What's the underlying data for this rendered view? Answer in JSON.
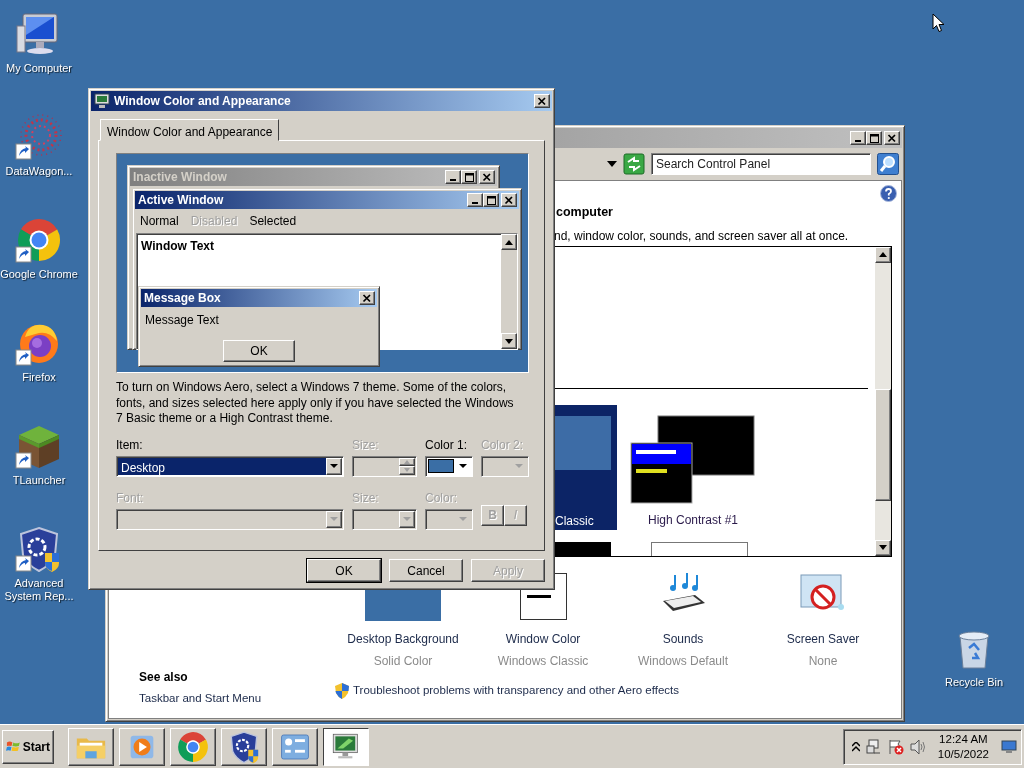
{
  "desktop_icons": [
    {
      "label": "My Computer",
      "kind": "computer",
      "shortcut": false
    },
    {
      "label": "DataWagon...",
      "kind": "dots",
      "shortcut": true
    },
    {
      "label": "Google Chrome",
      "kind": "ring",
      "shortcut": true
    },
    {
      "label": "Firefox",
      "kind": "flame",
      "shortcut": true
    },
    {
      "label": "TLauncher",
      "kind": "block",
      "shortcut": true
    },
    {
      "label": "Advanced System Rep...",
      "kind": "shield",
      "shortcut": true
    }
  ],
  "recycle_bin": {
    "label": "Recycle Bin"
  },
  "control_panel": {
    "search": {
      "placeholder": "Search Control Panel"
    },
    "heading": "computer",
    "description": "nd, window color, sounds, and screen saver all at once.",
    "themes": [
      {
        "label": "Classic",
        "kind": "classic",
        "selected": true
      },
      {
        "label": "High Contrast #1",
        "kind": "high_contrast",
        "selected": false
      }
    ],
    "settings": [
      {
        "kind": "background",
        "label": "Desktop Background",
        "value": "Solid Color"
      },
      {
        "kind": "window",
        "label": "Window Color",
        "value": "Windows Classic"
      },
      {
        "kind": "sounds",
        "label": "Sounds",
        "value": "Windows Default"
      },
      {
        "kind": "screensaver",
        "label": "Screen Saver",
        "value": "None"
      }
    ],
    "see_also": {
      "title": "See also",
      "links": [
        "Taskbar and Start Menu"
      ]
    },
    "troubleshoot_link": "Troubleshoot problems with transparency and other Aero effects"
  },
  "dialog": {
    "title": "Window Color and Appearance",
    "tabs": [
      {
        "label": "Window Color and Appearance",
        "selected": true
      }
    ],
    "preview": {
      "inactive_title": "Inactive Window",
      "active_title": "Active Window",
      "menu": [
        {
          "label": "Normal",
          "disabled": false
        },
        {
          "label": "Disabled",
          "disabled": true
        },
        {
          "label": "Selected",
          "disabled": false
        }
      ],
      "window_text": "Window Text",
      "message_title": "Message Box",
      "message_text": "Message Text",
      "ok": "OK"
    },
    "note": "To turn on Windows Aero, select a Windows 7 theme.  Some of the colors, fonts, and sizes selected here apply only if you have selected the Windows 7 Basic theme or a High Contrast theme.",
    "rows": [
      [
        {
          "label": "Item:",
          "kind": "dropdown",
          "value": "Desktop",
          "disabled": false
        },
        {
          "label": "Size:",
          "kind": "spinner",
          "disabled": true
        },
        {
          "label": "Color 1:",
          "kind": "color",
          "color": "#3a6ea5",
          "disabled": false
        },
        {
          "label": "Color 2:",
          "kind": "color",
          "disabled": true
        }
      ],
      [
        {
          "label": "Font:",
          "kind": "dropdown",
          "disabled": true
        },
        {
          "label": "Size:",
          "kind": "small_dropdown",
          "disabled": true
        },
        {
          "label": "Color:",
          "kind": "color",
          "disabled": true
        },
        {
          "kind": "toggles",
          "buttons": [
            "B",
            "I"
          ],
          "disabled": true
        }
      ]
    ],
    "buttons": [
      {
        "label": "OK",
        "disabled": false
      },
      {
        "label": "Cancel",
        "disabled": false
      },
      {
        "label": "Apply",
        "disabled": true
      }
    ]
  },
  "taskbar": {
    "start": "Start",
    "items": [
      {
        "kind": "folder",
        "selected": false
      },
      {
        "kind": "media",
        "selected": false
      },
      {
        "kind": "ring",
        "selected": false
      },
      {
        "kind": "shield",
        "selected": false
      },
      {
        "kind": "control",
        "selected": false
      },
      {
        "kind": "display",
        "selected": true
      }
    ],
    "time": "12:24 AM",
    "date": "10/5/2022"
  }
}
